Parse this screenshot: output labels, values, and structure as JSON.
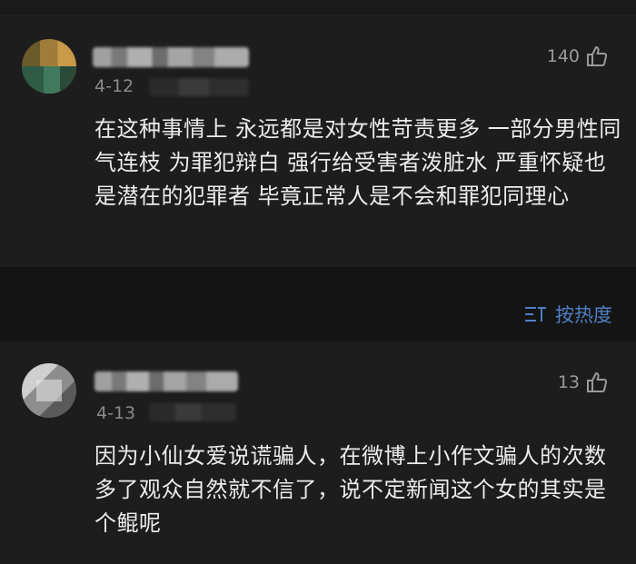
{
  "comments": [
    {
      "date": "4-12",
      "likes": "140",
      "text": "在这种事情上  永远都是对女性苛责更多 一部分男性同气连枝 为罪犯辩白 强行给受害者泼脏水 严重怀疑也是潜在的犯罪者 毕竟正常人是不会和罪犯同理心"
    },
    {
      "date": "4-13",
      "likes": "13",
      "text": "因为小仙女爱说谎骗人，在微博上小作文骗人的次数多了观众自然就不信了，说不定新闻这个女的其实是个鲲呢"
    }
  ],
  "sort": {
    "label": "按热度",
    "icon": "sort-icon",
    "color": "#4f7fc4"
  },
  "colors": {
    "background": "#161616",
    "card": "#1d1d1d",
    "text": "#ececec",
    "meta": "#8a8a8a"
  }
}
